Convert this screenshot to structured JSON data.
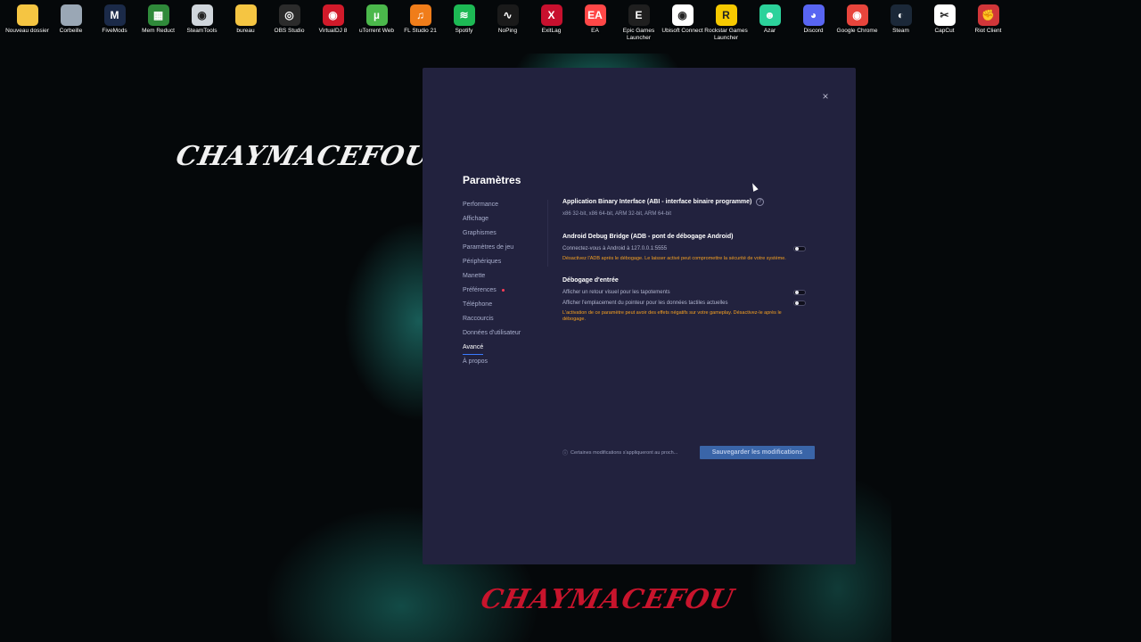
{
  "wallpaper": {
    "text_left": "CHAYMACEFOU",
    "text_bottom": "CHAYMACEFOU"
  },
  "desktop_icons": [
    {
      "label": "Nouveau dossier",
      "icon": "folder-icon",
      "color": "#f5c542",
      "glyph": ""
    },
    {
      "label": "Corbeille",
      "icon": "recycle-bin-icon",
      "color": "#9aa7b5",
      "glyph": ""
    },
    {
      "label": "FiveMods",
      "icon": "fivemods-icon",
      "color": "#1b2a48",
      "glyph": "M"
    },
    {
      "label": "Mem Reduct",
      "icon": "mem-reduct-icon",
      "color": "#2f8a3a",
      "glyph": "▦"
    },
    {
      "label": "SteamTools",
      "icon": "steamtools-icon",
      "color": "#d0d6dc",
      "glyph": "◉"
    },
    {
      "label": "bureau",
      "icon": "folder-icon",
      "color": "#f5c542",
      "glyph": ""
    },
    {
      "label": "OBS Studio",
      "icon": "obs-icon",
      "color": "#2b2b2b",
      "glyph": "◎"
    },
    {
      "label": "VirtualDJ 8",
      "icon": "virtualdj-icon",
      "color": "#d11a2a",
      "glyph": "◉"
    },
    {
      "label": "uTorrent Web",
      "icon": "utorrent-icon",
      "color": "#4bb84b",
      "glyph": "µ"
    },
    {
      "label": "FL Studio 21",
      "icon": "fl-studio-icon",
      "color": "#f07d1a",
      "glyph": "♫"
    },
    {
      "label": "Spotify",
      "icon": "spotify-icon",
      "color": "#1db954",
      "glyph": "≋"
    },
    {
      "label": "NoPing",
      "icon": "noping-icon",
      "color": "#1a1a1a",
      "glyph": "∿"
    },
    {
      "label": "ExitLag",
      "icon": "exitlag-icon",
      "color": "#c8102e",
      "glyph": "X"
    },
    {
      "label": "EA",
      "icon": "ea-icon",
      "color": "#ff4747",
      "glyph": "EA"
    },
    {
      "label": "Epic Games Launcher",
      "icon": "epic-games-icon",
      "color": "#1f1f1f",
      "glyph": "E"
    },
    {
      "label": "Ubisoft Connect",
      "icon": "ubisoft-icon",
      "color": "#ffffff",
      "glyph": "◉"
    },
    {
      "label": "Rockstar Games Launcher",
      "icon": "rockstar-icon",
      "color": "#f6c900",
      "glyph": "R"
    },
    {
      "label": "Azar",
      "icon": "azar-icon",
      "color": "#2cd29b",
      "glyph": "☻"
    },
    {
      "label": "Discord",
      "icon": "discord-icon",
      "color": "#5865f2",
      "glyph": "◕"
    },
    {
      "label": "Google Chrome",
      "icon": "chrome-icon",
      "color": "#e8453c",
      "glyph": "◉"
    },
    {
      "label": "Steam",
      "icon": "steam-icon",
      "color": "#1b2838",
      "glyph": "◐"
    },
    {
      "label": "CapCut",
      "icon": "capcut-icon",
      "color": "#ffffff",
      "glyph": "✂"
    },
    {
      "label": "Riot Client",
      "icon": "riot-icon",
      "color": "#d13639",
      "glyph": "✊"
    }
  ],
  "dialog": {
    "title": "Paramètres",
    "close_glyph": "×",
    "nav": [
      {
        "label": "Performance",
        "active": false,
        "dot": false
      },
      {
        "label": "Affichage",
        "active": false,
        "dot": false
      },
      {
        "label": "Graphismes",
        "active": false,
        "dot": false
      },
      {
        "label": "Paramètres de jeu",
        "active": false,
        "dot": false
      },
      {
        "label": "Périphériques",
        "active": false,
        "dot": false
      },
      {
        "label": "Manette",
        "active": false,
        "dot": false
      },
      {
        "label": "Préférences",
        "active": false,
        "dot": true
      },
      {
        "label": "Téléphone",
        "active": false,
        "dot": false
      },
      {
        "label": "Raccourcis",
        "active": false,
        "dot": false
      },
      {
        "label": "Données d'utilisateur",
        "active": false,
        "dot": false
      },
      {
        "label": "Avancé",
        "active": true,
        "dot": false
      },
      {
        "label": "À propos",
        "active": false,
        "dot": false
      }
    ],
    "abi": {
      "title": "Application Binary Interface (ABI - interface binaire programme)",
      "help_glyph": "?",
      "value": "x86 32-bit, x86 64-bit, ARM 32-bit, ARM 64-bit"
    },
    "adb": {
      "title": "Android Debug Bridge (ADB - pont de débogage Android)",
      "connect_label": "Connectez-vous à Android à 127.0.0.1:5555",
      "enabled": false,
      "warning": "Désactivez l'ADB après le débogage. Le laisser activé peut compromettre la sécurité de votre système."
    },
    "input_debug": {
      "title": "Débogage d'entrée",
      "options": [
        {
          "label": "Afficher un retour visuel pour les tapotements",
          "enabled": false
        },
        {
          "label": "Afficher l'emplacement du pointeur pour les données tactiles actuelles",
          "enabled": false
        }
      ],
      "warning": "L'activation de ce paramètre peut avoir des effets négatifs sur votre gameplay. Désactivez-le après le débogage."
    },
    "footer": {
      "info_glyph": "ⓘ",
      "note": "Certaines modifications s'appliqueront au proch...",
      "save_label": "Sauvegarder les modifications"
    }
  }
}
